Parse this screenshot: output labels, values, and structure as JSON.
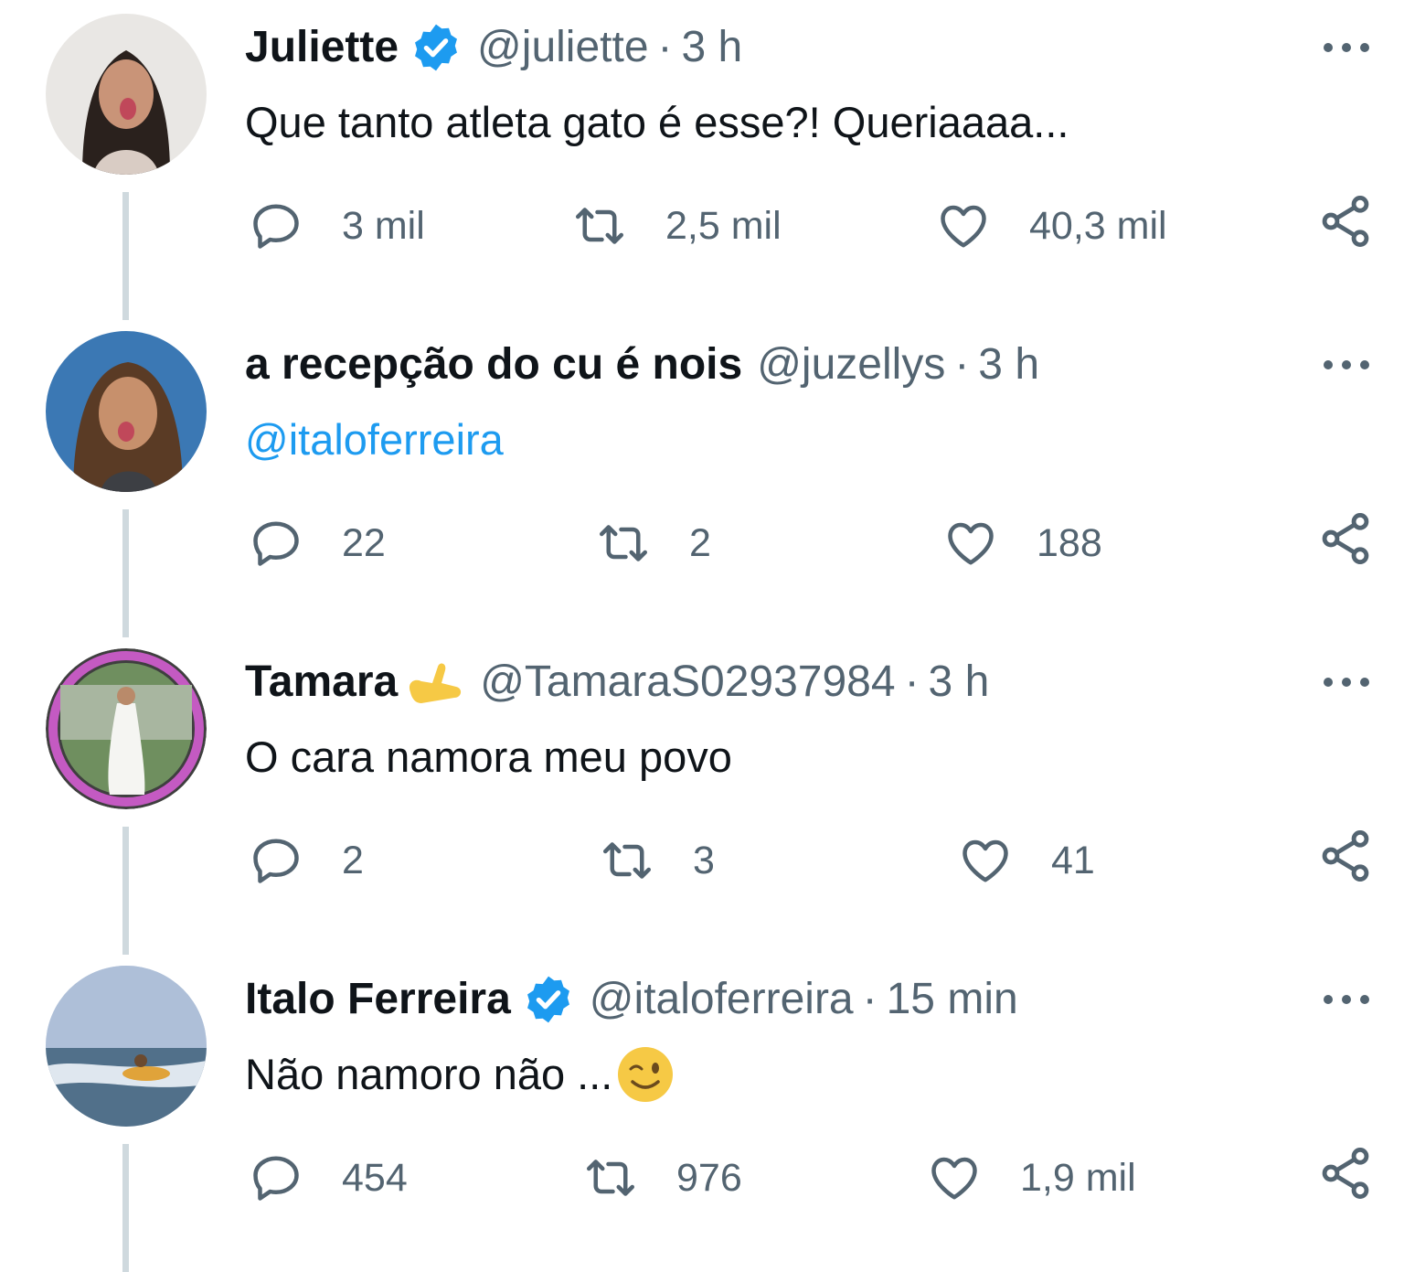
{
  "colors": {
    "link": "#1d9bf0",
    "verified": "#1d9bf0",
    "secondary_text": "#536471",
    "thread_line": "#cfd9de"
  },
  "tweets": [
    {
      "name": "Juliette",
      "verified": true,
      "handle": "@juliette",
      "separator": "·",
      "time": "3 h",
      "text": "Que tanto atleta gato é esse?! Queriaaaa...",
      "replies": "3 mil",
      "retweets": "2,5 mil",
      "likes": "40,3 mil"
    },
    {
      "name": "a recepção do cu é nois",
      "verified": false,
      "handle": "@juzellys",
      "separator": "·",
      "time": "3 h",
      "text": "@italoferreira",
      "replies": "22",
      "retweets": "2",
      "likes": "188"
    },
    {
      "name": "Tamara",
      "name_emoji": "call-me-hand-emoji",
      "verified": false,
      "handle": "@TamaraS02937984",
      "separator": "·",
      "time": "3 h",
      "text": "O cara namora meu povo",
      "replies": "2",
      "retweets": "3",
      "likes": "41"
    },
    {
      "name": "Italo Ferreira",
      "verified": true,
      "handle": "@italoferreira",
      "separator": "·",
      "time": "15 min",
      "text": "Não namoro não ...",
      "text_emoji": "winking-face-emoji",
      "replies": "454",
      "retweets": "976",
      "likes": "1,9 mil"
    }
  ]
}
